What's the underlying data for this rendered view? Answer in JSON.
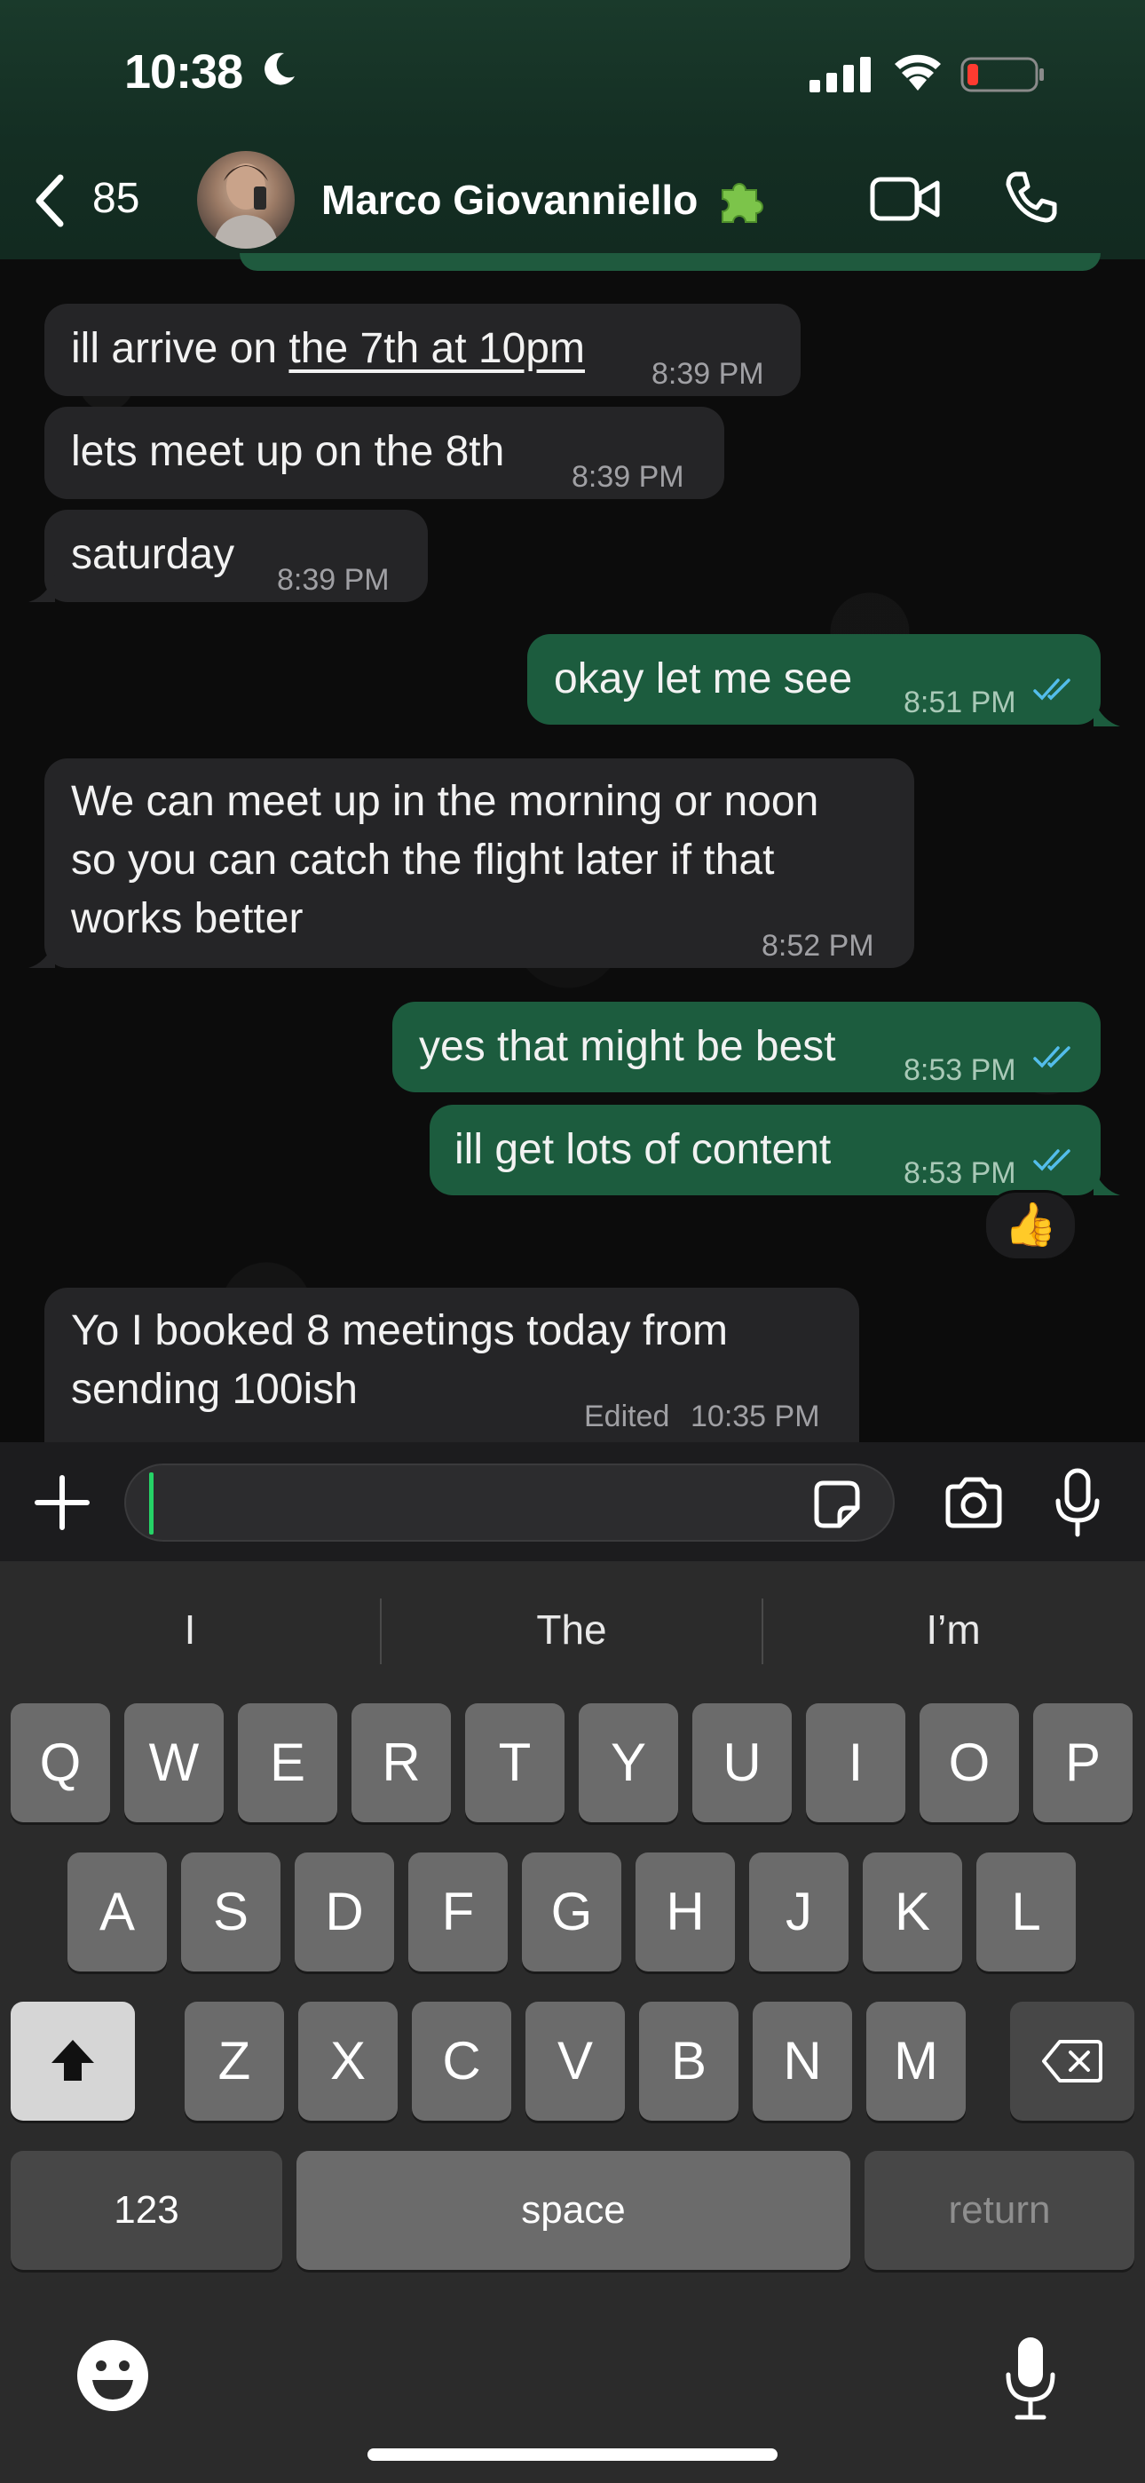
{
  "status_bar": {
    "time": "10:38"
  },
  "header": {
    "back_count": "85",
    "contact_name": "Marco Giovanniello"
  },
  "messages": [
    {
      "direction": "in",
      "parts": [
        "ill arrive on ",
        "the 7th at 10pm"
      ],
      "time": "8:39 PM"
    },
    {
      "direction": "in",
      "text": "lets meet up on the 8th",
      "time": "8:39 PM"
    },
    {
      "direction": "in",
      "text": "saturday",
      "time": "8:39 PM"
    },
    {
      "direction": "out",
      "text": "okay let me see",
      "time": "8:51 PM",
      "status": "read"
    },
    {
      "direction": "in",
      "lines": [
        "We can meet up in the morning or noon",
        "so you can catch the flight later if that",
        "works better"
      ],
      "time": "8:52 PM"
    },
    {
      "direction": "out",
      "text": "yes that might be best",
      "time": "8:53 PM",
      "status": "read"
    },
    {
      "direction": "out",
      "text": "ill get lots of content",
      "time": "8:53 PM",
      "status": "read",
      "reaction": "👍"
    },
    {
      "direction": "in",
      "lines": [
        "Yo I booked 8 meetings today from",
        "sending 100ish"
      ],
      "edited_label": "Edited",
      "time": "10:35 PM"
    }
  ],
  "composer": {
    "value": ""
  },
  "keyboard": {
    "suggestions": [
      "I",
      "The",
      "I’m"
    ],
    "row1": [
      "Q",
      "W",
      "E",
      "R",
      "T",
      "Y",
      "U",
      "I",
      "O",
      "P"
    ],
    "row2": [
      "A",
      "S",
      "D",
      "F",
      "G",
      "H",
      "J",
      "K",
      "L"
    ],
    "row3": [
      "Z",
      "X",
      "C",
      "V",
      "B",
      "N",
      "M"
    ],
    "numbers_label": "123",
    "space_label": "space",
    "return_label": "return"
  },
  "colors": {
    "outgoing_bubble": "#1c5c3e",
    "incoming_bubble": "#252527",
    "read_ticks": "#53bdeb",
    "accent": "#25d366"
  },
  "icons": [
    "moon-icon",
    "signal-icon",
    "wifi-icon",
    "battery-icon",
    "back-chevron-icon",
    "puzzle-emoji-icon",
    "video-call-icon",
    "phone-icon",
    "plus-icon",
    "sticker-icon",
    "camera-icon",
    "mic-icon",
    "shift-icon",
    "backspace-icon",
    "emoji-icon",
    "dictation-icon"
  ]
}
